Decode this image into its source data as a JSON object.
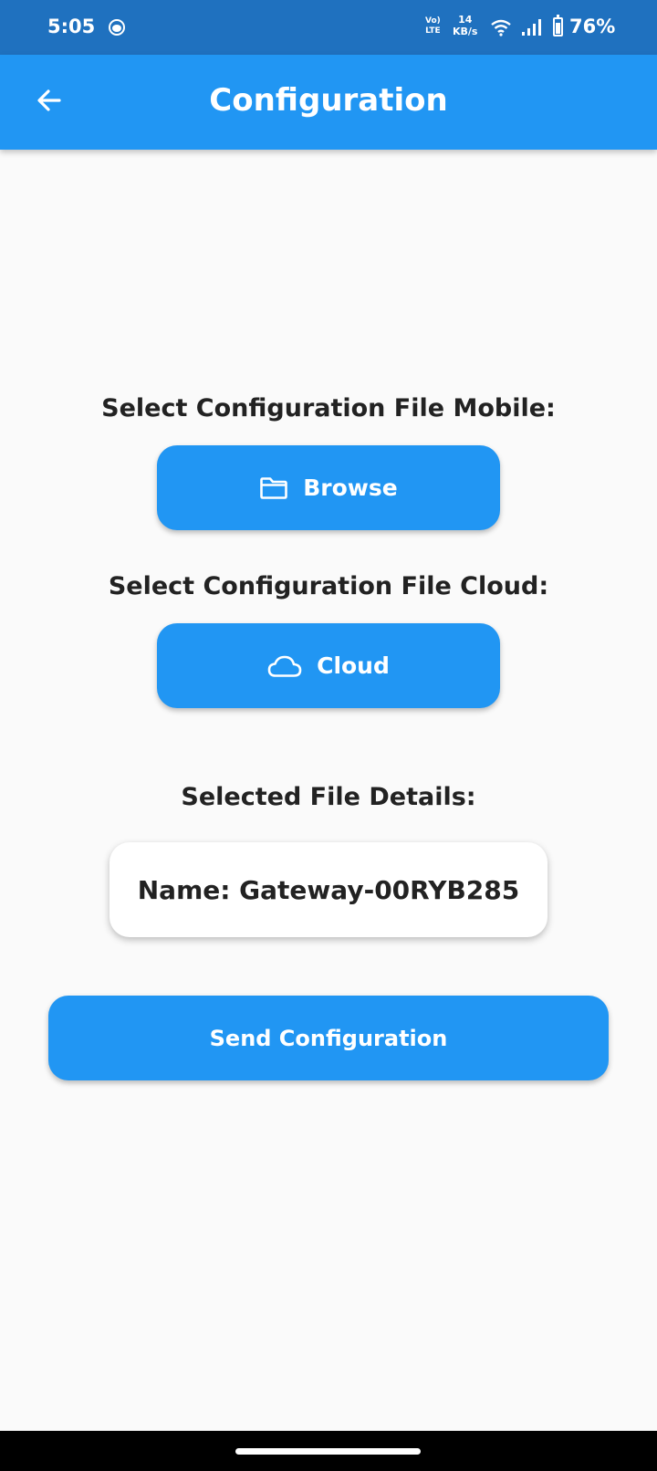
{
  "status_bar": {
    "time": "5:05",
    "lte_top": "Vo)",
    "lte_bottom": "LTE",
    "speed_value": "14",
    "speed_unit": "KB/s",
    "battery": "76%"
  },
  "app_bar": {
    "title": "Configuration",
    "back_icon": "arrow-left-icon"
  },
  "main": {
    "mobile_label": "Select Configuration File Mobile:",
    "browse_label": "Browse",
    "browse_icon": "folder-icon",
    "cloud_section_label": "Select Configuration File Cloud:",
    "cloud_label": "Cloud",
    "cloud_icon": "cloud-icon",
    "details_label": "Selected File Details:",
    "file_name": "Name: Gateway-00RYB285",
    "send_label": "Send Configuration"
  },
  "colors": {
    "status_bar": "#1f71bf",
    "primary": "#2196f3",
    "background": "#fafafa",
    "text": "#222222"
  }
}
